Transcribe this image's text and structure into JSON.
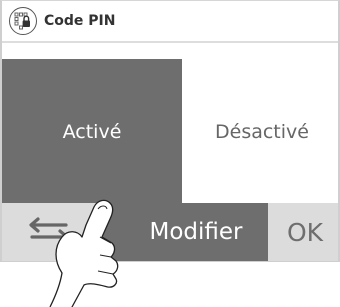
{
  "header": {
    "title": "Code PIN",
    "icon": "pin-lock-icon"
  },
  "options": {
    "active_label": "Activé",
    "inactive_label": "Désactivé",
    "selected": "active"
  },
  "buttons": {
    "back_icon": "back-arrow-icon",
    "modify_label": "Modifier",
    "ok_label": "OK"
  },
  "colors": {
    "selected_bg": "#6e6e6e",
    "button_bg": "#dcdcdc",
    "text_dark": "#333333"
  }
}
